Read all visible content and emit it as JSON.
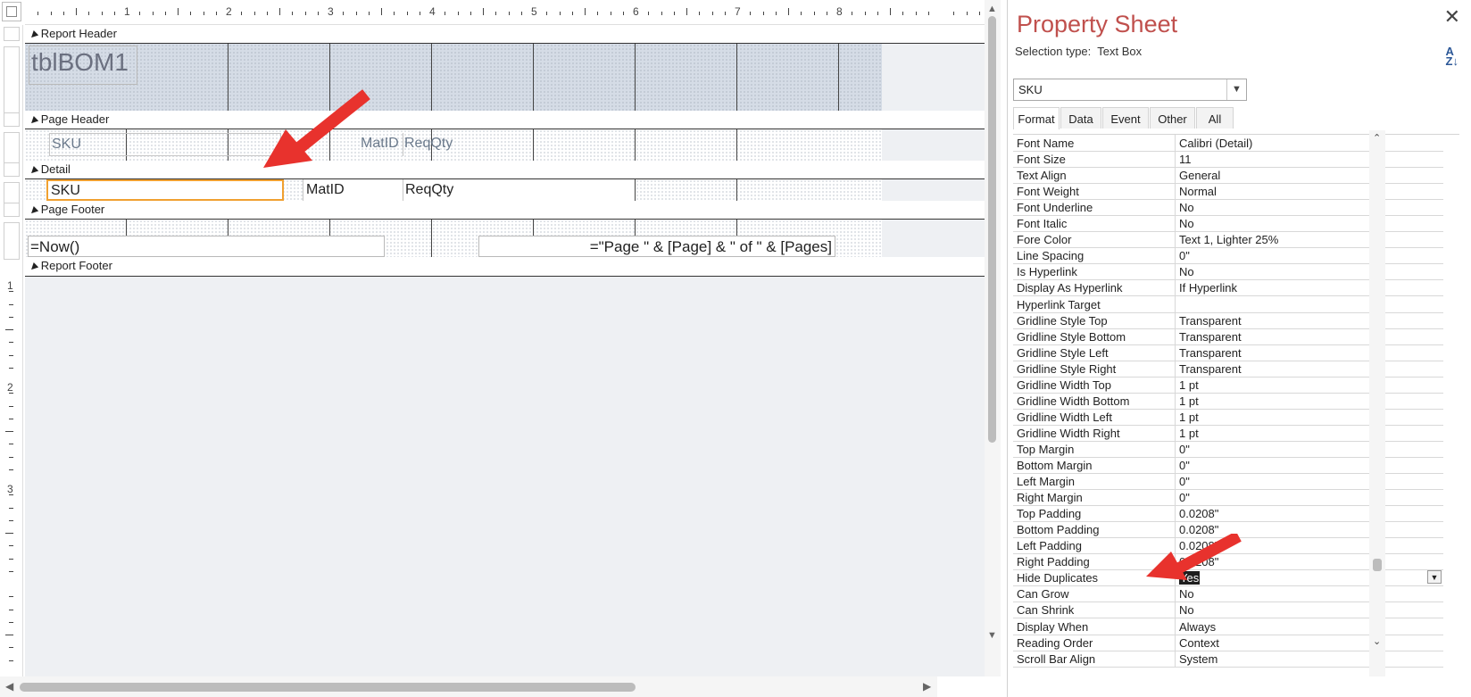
{
  "ruler": {
    "numbers": [
      "1",
      "2",
      "3",
      "4",
      "5",
      "6",
      "7",
      "8"
    ],
    "vnumbers": [
      "1",
      "2",
      "3"
    ]
  },
  "bands": {
    "report_header": "Report Header",
    "page_header": "Page Header",
    "detail": "Detail",
    "page_footer": "Page Footer",
    "report_footer": "Report Footer"
  },
  "controls": {
    "report_title": "tblBOM1",
    "ph_sku": "SKU",
    "ph_matid": "MatID",
    "ph_reqqty": "ReqQty",
    "d_sku": "SKU",
    "d_matid": "MatID",
    "d_reqqty": "ReqQty",
    "pf_now": "=Now()",
    "pf_pages": "=\"Page \" & [Page] & \" of \" & [Pages]"
  },
  "property_sheet": {
    "title": "Property Sheet",
    "selection_type_label": "Selection type:",
    "selection_type": "Text Box",
    "selected_control": "SKU",
    "tabs": [
      "Format",
      "Data",
      "Event",
      "Other",
      "All"
    ],
    "active_tab": "Format",
    "properties": [
      {
        "name": "Font Name",
        "value": "Calibri (Detail)"
      },
      {
        "name": "Font Size",
        "value": "11"
      },
      {
        "name": "Text Align",
        "value": "General"
      },
      {
        "name": "Font Weight",
        "value": "Normal"
      },
      {
        "name": "Font Underline",
        "value": "No"
      },
      {
        "name": "Font Italic",
        "value": "No"
      },
      {
        "name": "Fore Color",
        "value": "Text 1, Lighter 25%"
      },
      {
        "name": "Line Spacing",
        "value": "0\""
      },
      {
        "name": "Is Hyperlink",
        "value": "No"
      },
      {
        "name": "Display As Hyperlink",
        "value": "If Hyperlink"
      },
      {
        "name": "Hyperlink Target",
        "value": ""
      },
      {
        "name": "Gridline Style Top",
        "value": "Transparent"
      },
      {
        "name": "Gridline Style Bottom",
        "value": "Transparent"
      },
      {
        "name": "Gridline Style Left",
        "value": "Transparent"
      },
      {
        "name": "Gridline Style Right",
        "value": "Transparent"
      },
      {
        "name": "Gridline Width Top",
        "value": "1 pt"
      },
      {
        "name": "Gridline Width Bottom",
        "value": "1 pt"
      },
      {
        "name": "Gridline Width Left",
        "value": "1 pt"
      },
      {
        "name": "Gridline Width Right",
        "value": "1 pt"
      },
      {
        "name": "Top Margin",
        "value": "0\""
      },
      {
        "name": "Bottom Margin",
        "value": "0\""
      },
      {
        "name": "Left Margin",
        "value": "0\""
      },
      {
        "name": "Right Margin",
        "value": "0\""
      },
      {
        "name": "Top Padding",
        "value": "0.0208\""
      },
      {
        "name": "Bottom Padding",
        "value": "0.0208\""
      },
      {
        "name": "Left Padding",
        "value": "0.0208\""
      },
      {
        "name": "Right Padding",
        "value": "0.0208\""
      },
      {
        "name": "Hide Duplicates",
        "value": "Yes",
        "selected": true
      },
      {
        "name": "Can Grow",
        "value": "No"
      },
      {
        "name": "Can Shrink",
        "value": "No"
      },
      {
        "name": "Display When",
        "value": "Always"
      },
      {
        "name": "Reading Order",
        "value": "Context"
      },
      {
        "name": "Scroll Bar Align",
        "value": "System"
      }
    ]
  },
  "colors": {
    "title_accent": "#c0504d",
    "callout_red": "#e8322d",
    "selection_orange": "#f0a030"
  },
  "icons": {
    "close": "close-icon",
    "sort": "sort-az-icon",
    "dropdown": "chevron-down-icon",
    "band_arrow": "band-arrow-icon"
  }
}
